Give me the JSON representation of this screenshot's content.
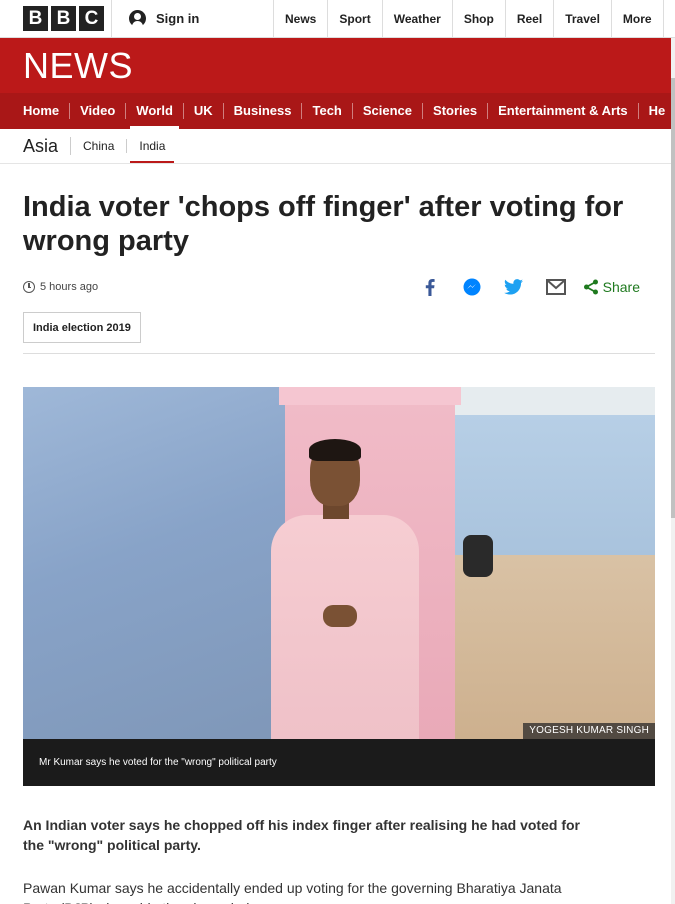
{
  "brand": {
    "letters": [
      "B",
      "B",
      "C"
    ],
    "news_wordmark": "NEWS"
  },
  "topbar": {
    "signin_label": "Sign in",
    "links": [
      "News",
      "Sport",
      "Weather",
      "Shop",
      "Reel",
      "Travel",
      "More"
    ]
  },
  "section_nav": {
    "items": [
      "Home",
      "Video",
      "World",
      "UK",
      "Business",
      "Tech",
      "Science",
      "Stories",
      "Entertainment & Arts",
      "He"
    ],
    "active": "World"
  },
  "sub_nav": {
    "region": "Asia",
    "items": [
      "China",
      "India"
    ],
    "active": "India"
  },
  "article": {
    "headline": "India voter 'chops off finger' after voting for wrong party",
    "timestamp": "5 hours ago",
    "share_label": "Share",
    "share_icons": [
      "facebook-icon",
      "messenger-icon",
      "twitter-icon",
      "email-icon",
      "share-icon"
    ],
    "tag": "India election 2019",
    "image": {
      "credit": "YOGESH KUMAR SINGH",
      "caption": "Mr Kumar says he voted for the \"wrong\" political party"
    },
    "lede": "An Indian voter says he chopped off his index finger after realising he had voted for the \"wrong\" political party.",
    "body": "Pawan Kumar says he accidentally ended up voting for the governing Bharatiya Janata Party (BJP) alongside the glove-clad..."
  },
  "colors": {
    "brand_red": "#bb1919",
    "nav_red": "#a91717",
    "share_green": "#1f7a1f",
    "facebook_blue": "#3b5998",
    "twitter_blue": "#1da1f2"
  }
}
